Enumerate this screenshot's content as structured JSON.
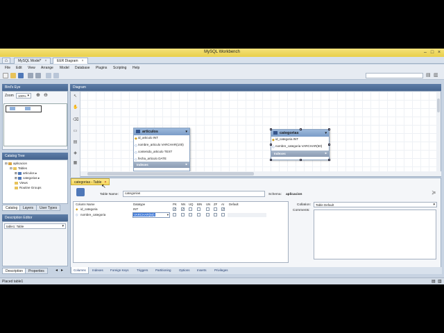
{
  "window": {
    "title": "MySQL Workbench"
  },
  "tabs": [
    {
      "label": "MySQL Model*"
    },
    {
      "label": "EER Diagram"
    }
  ],
  "menu": [
    "File",
    "Edit",
    "View",
    "Arrange",
    "Model",
    "Database",
    "Plugins",
    "Scripting",
    "Help"
  ],
  "birds_eye": {
    "title": "Bird's Eye",
    "zoom_label": "Zoom",
    "zoom_value": "100%"
  },
  "catalog": {
    "title": "Catalog Tree",
    "schema": "aplicacion",
    "tables_folder": "Tables",
    "tables": [
      "articulos",
      "categorias"
    ],
    "views": "Views",
    "routine_groups": "Routine Groups"
  },
  "side_tabs": [
    "Catalog",
    "Layers",
    "User Types"
  ],
  "description_editor": {
    "title": "Description Editor",
    "select_value": "table1: Table"
  },
  "desc_tabs": [
    "Description",
    "Properties"
  ],
  "diagram": {
    "title": "Diagram",
    "entities": [
      {
        "name": "articulos",
        "fields": [
          "id_articulo INT",
          "nombre_articulo VARCHAR(100)",
          "contenido_articulo TEXT",
          "fecha_articulo DATE"
        ],
        "footer": "Indexes"
      },
      {
        "name": "categorias",
        "fields": [
          "id_categoria INT",
          "nombre_categoria VARCHAR(50)"
        ],
        "footer": "Indexes"
      }
    ]
  },
  "editor": {
    "tab_label": "categorias - Table",
    "table_name_label": "Table Name:",
    "table_name": "categorias",
    "schema_label": "Schema:",
    "schema_value": "aplicacion",
    "collation_label": "Collation:",
    "collation_value": "Table Default",
    "comments_label": "Comments:",
    "columns_header": [
      "Column Name",
      "Datatype",
      "PK",
      "NN",
      "UQ",
      "BIN",
      "UN",
      "ZF",
      "AI",
      "Default"
    ],
    "columns": [
      {
        "name": "id_categoria",
        "type": "INT",
        "flags": [
          true,
          true,
          false,
          false,
          false,
          false,
          true
        ]
      },
      {
        "name": "nombre_categoria",
        "type": "VARCHAR(50)",
        "flags": [
          false,
          false,
          false,
          false,
          false,
          false,
          false
        ]
      }
    ],
    "bottom_tabs": [
      "Columns",
      "Indexes",
      "Foreign Keys",
      "Triggers",
      "Partitioning",
      "Options",
      "Inserts",
      "Privileges"
    ]
  },
  "status": {
    "text": "Placed table1"
  }
}
